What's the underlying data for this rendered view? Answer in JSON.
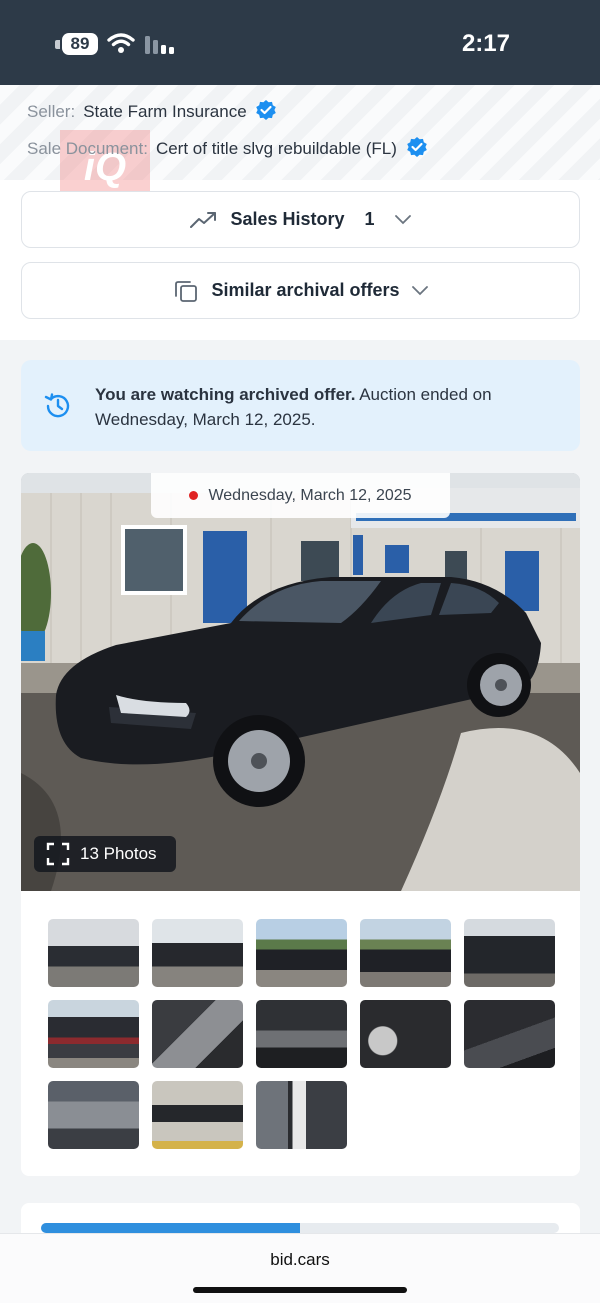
{
  "status_bar": {
    "battery": "89",
    "time": "2:17"
  },
  "seller": {
    "seller_label": "Seller:",
    "seller_value": "State Farm Insurance",
    "document_label": "Sale Document:",
    "document_value": "Cert of title slvg rebuildable (FL)",
    "watermark": "iQ"
  },
  "sales_history": {
    "label": "Sales History",
    "count": "1"
  },
  "similar_offers": {
    "label": "Similar archival offers"
  },
  "archived_alert": {
    "bold": "You are watching archived offer.",
    "text": " Auction ended on Wednesday, March 12, 2025."
  },
  "gallery": {
    "date": "Wednesday, March 12, 2025",
    "photos_button": "13 Photos",
    "thumbnails": [
      "front-left exterior",
      "rear-left exterior",
      "rear-left exterior",
      "front-left exterior",
      "front exterior",
      "rear damage",
      "front seats interior",
      "dashboard interior",
      "instrument cluster",
      "rear seats interior",
      "engine bay",
      "damaged part",
      "door jamb label"
    ]
  },
  "bid_progress": {
    "fraction": 0.5
  },
  "browser": {
    "url": "bid.cars"
  },
  "colors": {
    "accent": "#2f8fde",
    "status_bar": "#2d3a48",
    "alert_bg": "#e3f1fc",
    "verified": "#1d8ff0"
  }
}
